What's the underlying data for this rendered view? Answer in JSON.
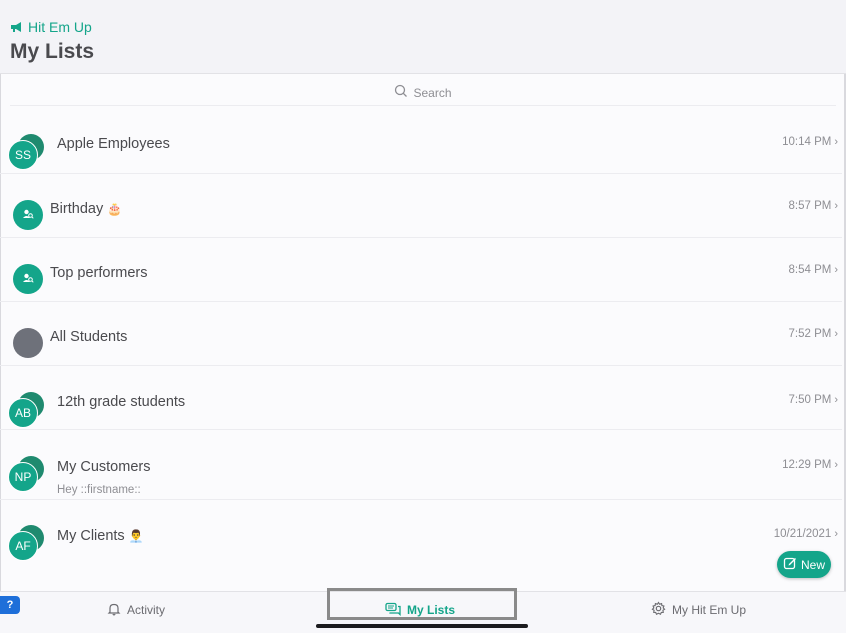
{
  "header": {
    "back_label": "Hit Em Up",
    "title": "My Lists"
  },
  "search": {
    "placeholder": "Search"
  },
  "lists": [
    {
      "avatar_type": "initials",
      "initials": "SS",
      "title": "Apple Employees",
      "emoji": "",
      "subtitle": "",
      "time": "10:14 PM"
    },
    {
      "avatar_type": "group",
      "initials": "",
      "title": "Birthday",
      "emoji": "🎂",
      "subtitle": "",
      "time": "8:57 PM"
    },
    {
      "avatar_type": "group",
      "initials": "",
      "title": "Top performers",
      "emoji": "",
      "subtitle": "",
      "time": "8:54 PM"
    },
    {
      "avatar_type": "gray",
      "initials": "",
      "title": "All Students",
      "emoji": "",
      "subtitle": "",
      "time": "7:52 PM"
    },
    {
      "avatar_type": "initials",
      "initials": "AB",
      "title": "12th grade students",
      "emoji": "",
      "subtitle": "",
      "time": "7:50 PM"
    },
    {
      "avatar_type": "initials",
      "initials": "NP",
      "title": "My Customers",
      "emoji": "",
      "subtitle": "Hey ::firstname::",
      "time": "12:29 PM"
    },
    {
      "avatar_type": "initials",
      "initials": "AF",
      "title": "My Clients",
      "emoji": "👨‍💼",
      "subtitle": "",
      "time": "10/21/2021"
    }
  ],
  "new_button": {
    "label": "New"
  },
  "tabbar": {
    "tabs": [
      {
        "label": "Activity",
        "icon": "bell-icon"
      },
      {
        "label": "My Lists",
        "icon": "chat-bubbles-icon"
      },
      {
        "label": "My Hit Em Up",
        "icon": "gear-icon"
      }
    ]
  },
  "help_badge": "?",
  "colors": {
    "accent": "#14a58a",
    "gray_avatar": "#6e717a",
    "highlight_border": "#8a8a8a"
  }
}
